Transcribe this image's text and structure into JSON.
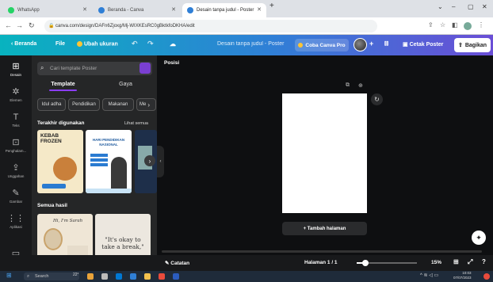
{
  "browser": {
    "tabs": [
      {
        "label": "WhatsApp",
        "icon": "whatsapp-icon",
        "color": "#25d366"
      },
      {
        "label": "Beranda - Canva",
        "icon": "canva-icon",
        "color": "#2f7fd6"
      },
      {
        "label": "Desain tanpa judul - Poster",
        "icon": "canva-icon",
        "color": "#2f7fd6"
      }
    ],
    "new_tab": "+",
    "url": "canva.com/design/DAFn6Zjoxg/Mj-WIXKEsRC0gBktkfoDKHA/edit",
    "window_controls": [
      "⌄",
      "–",
      "▢",
      "✕"
    ]
  },
  "toolbar": {
    "home": "Beranda",
    "file": "File",
    "resize": "Ubah ukuran",
    "doc_title": "Desain tanpa judul - Poster",
    "try_pro": "Coba Canva Pro",
    "print": "Cetak Poster",
    "share": "Bagikan",
    "brand_color": "#08b3bf",
    "accent_color": "#8b3dff"
  },
  "rail": [
    {
      "label": "Desain",
      "glyph": "⊞",
      "icon": "design-icon"
    },
    {
      "label": "Elemen",
      "glyph": "✲",
      "icon": "elements-icon"
    },
    {
      "label": "Teks",
      "glyph": "T",
      "icon": "text-icon"
    },
    {
      "label": "Penghalam...",
      "glyph": "⊡",
      "icon": "brand-icon"
    },
    {
      "label": "Unggahan",
      "glyph": "⇪",
      "icon": "upload-icon"
    },
    {
      "label": "Gambar",
      "glyph": "✎",
      "icon": "draw-icon"
    },
    {
      "label": "Aplikasi",
      "glyph": "⋮⋮",
      "icon": "apps-icon"
    },
    {
      "label": "Proyek",
      "glyph": "▭",
      "icon": "projects-icon"
    }
  ],
  "panel": {
    "search_placeholder": "Cari template Poster",
    "tabs": [
      "Template",
      "Gaya"
    ],
    "chips": [
      "Idul adha",
      "Pendidikan",
      "Makanan",
      "Me"
    ],
    "recent_title": "Terakhir digunakan",
    "see_all": "Lihat semua",
    "all_results": "Semua hasil",
    "recent": [
      {
        "title": "KEBAB FROZEN",
        "bg": "#f5e9c8"
      },
      {
        "title": "HARI PENDIDIKAN NASIONAL",
        "bg": "#ffffff"
      }
    ],
    "results": [
      {
        "title": "Hi, I'm Sarah",
        "bg": "#efe6d6"
      },
      {
        "title": "\"It's okay to take a break,\"",
        "bg": "#ece7df"
      }
    ]
  },
  "canvas": {
    "position_label": "Posisi",
    "add_page": "+ Tambah halaman"
  },
  "status": {
    "notes": "Catatan",
    "page": "Halaman 1 / 1",
    "zoom": "15%",
    "zoom_fraction": 0.15
  },
  "taskbar": {
    "search": "Search",
    "temp": "22°",
    "time": "10:03",
    "date": "07/07/2023"
  }
}
